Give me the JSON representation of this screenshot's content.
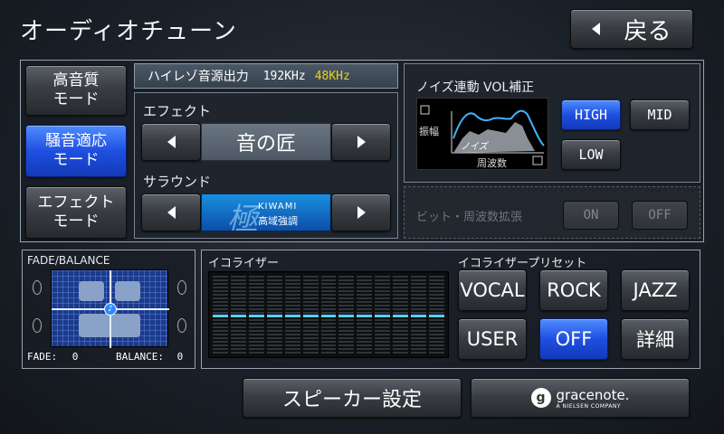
{
  "header": {
    "title": "オーディオチューン",
    "back_label": "戻る"
  },
  "modes": [
    {
      "label_line1": "高音質",
      "label_line2": "モード",
      "active": false
    },
    {
      "label_line1": "騒音適応",
      "label_line2": "モード",
      "active": true
    },
    {
      "label_line1": "エフェクト",
      "label_line2": "モード",
      "active": false
    }
  ],
  "hires": {
    "label": "ハイレゾ音源出力",
    "rate1": "192KHz",
    "rate2": "48KHz",
    "rate2_color": "#e8d020"
  },
  "effect": {
    "label": "エフェクト",
    "value": "音の匠"
  },
  "surround": {
    "label": "サラウンド",
    "logo_text": "KIWAMI",
    "logo_sub": "高域強調"
  },
  "noise": {
    "title": "ノイズ連動 VOL補正",
    "graph_y_label": "振幅",
    "graph_inner_label": "ノイズ",
    "graph_x_label": "周波数",
    "high": "HIGH",
    "mid": "MID",
    "low": "LOW",
    "selected": "HIGH"
  },
  "bit": {
    "label": "ビット・周波数拡張",
    "on": "ON",
    "off": "OFF"
  },
  "fade": {
    "title": "FADE/BALANCE",
    "fade_label": "FADE:",
    "fade_value": "0",
    "balance_label": "BALANCE:",
    "balance_value": "0"
  },
  "eq": {
    "title": "イコライザー",
    "bands": 13
  },
  "preset": {
    "title": "イコライザープリセット",
    "vocal": "VOCAL",
    "rock": "ROCK",
    "jazz": "JAZZ",
    "user": "USER",
    "off": "OFF",
    "detail": "詳細",
    "selected": "OFF"
  },
  "footer": {
    "speaker_label": "スピーカー設定",
    "gracenote_name": "gracenote.",
    "gracenote_sub": "A NIELSEN COMPANY"
  },
  "colors": {
    "accent_blue": "#1f4fe0",
    "eq_level": "#4fd2ff"
  }
}
